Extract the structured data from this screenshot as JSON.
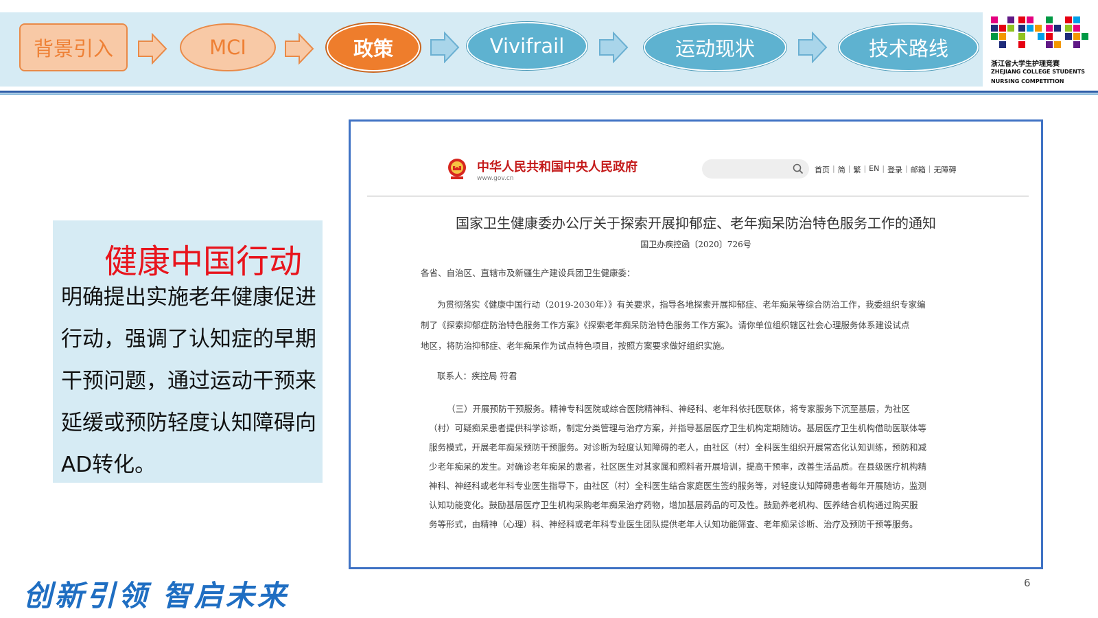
{
  "nav": {
    "steps": [
      {
        "label": "背景引入",
        "state": "done"
      },
      {
        "label": "MCI",
        "state": "done"
      },
      {
        "label": "政策",
        "state": "active"
      },
      {
        "label": "Vivifrail",
        "state": "todo"
      },
      {
        "label": "运动现状",
        "state": "todo"
      },
      {
        "label": "技术路线",
        "state": "todo"
      }
    ]
  },
  "logo": {
    "line1": "浙江省大学生护理竞赛",
    "line2": "ZHEJIANG COLLEGE STUDENTS",
    "line3": "NURSING COMPETITION"
  },
  "info": {
    "title": "健康中国行动",
    "body": "明确提出实施老年健康促进行动，强调了认知症的早期干预问题，通过运动干预来延缓或预防轻度认知障碍向AD转化。"
  },
  "doc": {
    "site_name": "中华人民共和国中央人民政府",
    "site_url": "www.gov.cn",
    "links": [
      "首页",
      "简",
      "繁",
      "EN",
      "登录",
      "邮箱",
      "无障碍"
    ],
    "title": "国家卫生健康委办公厅关于探索开展抑郁症、老年痴呆防治特色服务工作的通知",
    "number": "国卫办疾控函〔2020〕726号",
    "salutation": "各省、自治区、直辖市及新疆生产建设兵团卫生健康委：",
    "para1": [
      "为贯彻落实《健康中国行动（2019-2030年）》有关要求，指导各地探索开展抑郁症、老年痴呆等综合防治工作，我委组织专家编",
      "制了《探索抑郁症防治特色服务工作方案》《探索老年痴呆防治特色服务工作方案》。请你单位组织辖区社会心理服务体系建设试点",
      "地区，将防治抑郁症、老年痴呆作为试点特色项目，按照方案要求做好组织实施。"
    ],
    "contact": "联系人：疾控局  符君",
    "para2": [
      "（三）开展预防干预服务。精神专科医院或综合医院精神科、神经科、老年科依托医联体，将专家服务下沉至基层，为社区",
      "（村）可疑痴呆患者提供科学诊断，制定分类管理与治疗方案，并指导基层医疗卫生机构定期随访。基层医疗卫生机构借助医联体等",
      "服务模式，开展老年痴呆预防干预服务。对诊断为轻度认知障碍的老人，由社区（村）全科医生组织开展常态化认知训练，预防和减",
      "少老年痴呆的发生。对确诊老年痴呆的患者，社区医生对其家属和照料者开展培训，提高干预率，改善生活品质。在县级医疗机构精",
      "神科、神经科或老年科专业医生指导下，由社区（村）全科医生结合家庭医生签约服务等，对轻度认知障碍患者每年开展随访，监测",
      "认知功能变化。鼓励基层医疗卫生机构采购老年痴呆治疗药物，增加基层药品的可及性。鼓励养老机构、医养结合机构通过购买服",
      "务等形式，由精神（心理）科、神经科或老年科专业医生团队提供老年人认知功能筛查、老年痴呆诊断、治疗及预防干预等服务。"
    ]
  },
  "footer": {
    "slogan": "创新引领  智启未来",
    "page": "6"
  },
  "colors": {
    "accent_orange": "#ee7d2c",
    "accent_blue": "#5eb2d0",
    "title_red": "#e8141c",
    "frame_blue": "#3f72c4"
  }
}
